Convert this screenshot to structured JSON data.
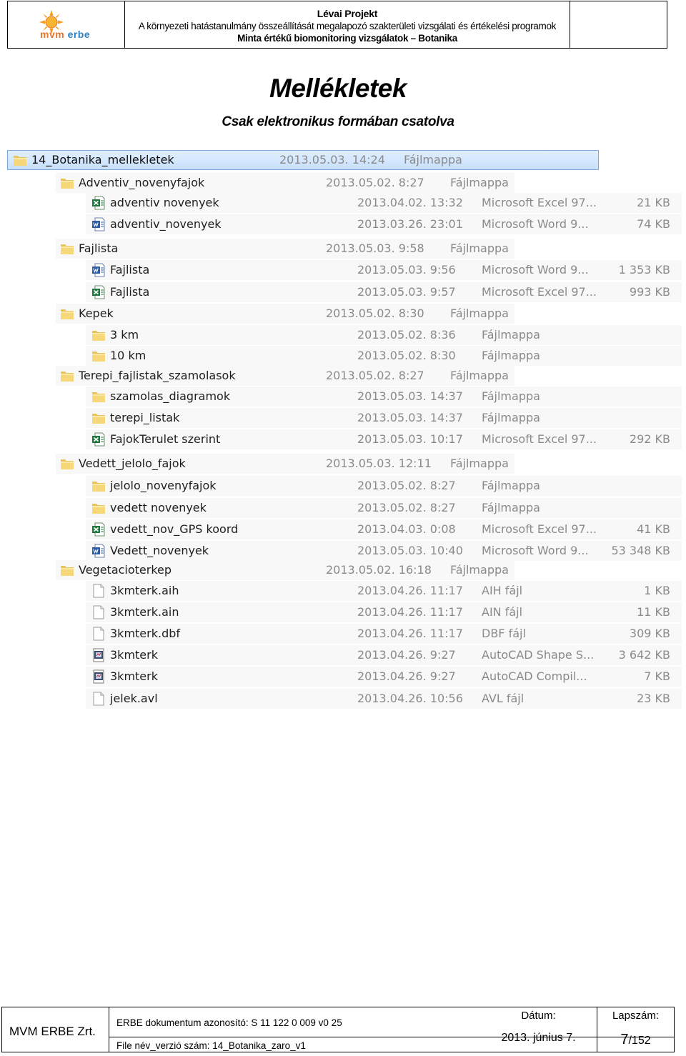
{
  "header": {
    "project": "Lévai Projekt",
    "line2": "A környezeti hatástanulmány összeállítását megalapozó szakterületi vizsgálati és értékelési programok",
    "line3": "Minta értékű biomonitoring vizsgálatok – Botanika",
    "logo_text_a": "mvm",
    "logo_text_b": " erbe"
  },
  "title": "Mellékletek",
  "subtitle": "Csak elektronikus formában csatolva",
  "listing": [
    {
      "name": "14_Botanika_mellekletek",
      "date": "2013.05.03. 14:24",
      "type": "Fájlmappa",
      "size": "",
      "icon": "folder-icon"
    },
    {
      "name": "Adventiv_novenyfajok",
      "date": "2013.05.02. 8:27",
      "type": "Fájlmappa",
      "size": "",
      "icon": "folder-icon"
    },
    {
      "name": "adventiv novenyek",
      "date": "2013.04.02. 13:32",
      "type": "Microsoft Excel 97...",
      "size": "21 KB",
      "icon": "excel-file-icon"
    },
    {
      "name": "adventiv_novenyek",
      "date": "2013.03.26. 23:01",
      "type": "Microsoft Word 9...",
      "size": "74 KB",
      "icon": "word-file-icon"
    },
    {
      "name": "Fajlista",
      "date": "2013.05.03. 9:58",
      "type": "Fájlmappa",
      "size": "",
      "icon": "folder-icon"
    },
    {
      "name": "Fajlista",
      "date": "2013.05.03. 9:56",
      "type": "Microsoft Word 9...",
      "size": "1 353 KB",
      "icon": "word-file-icon"
    },
    {
      "name": "Fajlista",
      "date": "2013.05.03. 9:57",
      "type": "Microsoft Excel 97...",
      "size": "993 KB",
      "icon": "excel-file-icon"
    },
    {
      "name": "Kepek",
      "date": "2013.05.02. 8:30",
      "type": "Fájlmappa",
      "size": "",
      "icon": "folder-icon"
    },
    {
      "name": "3 km",
      "date": "2013.05.02. 8:36",
      "type": "Fájlmappa",
      "size": "",
      "icon": "folder-icon"
    },
    {
      "name": "10 km",
      "date": "2013.05.02. 8:30",
      "type": "Fájlmappa",
      "size": "",
      "icon": "folder-icon"
    },
    {
      "name": "Terepi_fajlistak_szamolasok",
      "date": "2013.05.02. 8:27",
      "type": "Fájlmappa",
      "size": "",
      "icon": "folder-icon"
    },
    {
      "name": "szamolas_diagramok",
      "date": "2013.05.03. 14:37",
      "type": "Fájlmappa",
      "size": "",
      "icon": "folder-icon"
    },
    {
      "name": "terepi_listak",
      "date": "2013.05.03. 14:37",
      "type": "Fájlmappa",
      "size": "",
      "icon": "folder-icon"
    },
    {
      "name": "FajokTerulet szerint",
      "date": "2013.05.03. 10:17",
      "type": "Microsoft Excel 97...",
      "size": "292 KB",
      "icon": "excel-file-icon"
    },
    {
      "name": "Vedett_jelolo_fajok",
      "date": "2013.05.03. 12:11",
      "type": "Fájlmappa",
      "size": "",
      "icon": "folder-icon"
    },
    {
      "name": "jelolo_novenyfajok",
      "date": "2013.05.02. 8:27",
      "type": "Fájlmappa",
      "size": "",
      "icon": "folder-icon"
    },
    {
      "name": "vedett novenyek",
      "date": "2013.05.02. 8:27",
      "type": "Fájlmappa",
      "size": "",
      "icon": "folder-icon"
    },
    {
      "name": "vedett_nov_GPS koord",
      "date": "2013.04.03. 0:08",
      "type": "Microsoft Excel 97...",
      "size": "41 KB",
      "icon": "excel-file-icon"
    },
    {
      "name": "Vedett_novenyek",
      "date": "2013.05.03. 10:40",
      "type": "Microsoft Word 9...",
      "size": "53 348 KB",
      "icon": "word-file-icon"
    },
    {
      "name": "Vegetacioterkep",
      "date": "2013.05.02. 16:18",
      "type": "Fájlmappa",
      "size": "",
      "icon": "folder-icon"
    },
    {
      "name": "3kmterk.aih",
      "date": "2013.04.26. 11:17",
      "type": "AIH fájl",
      "size": "1 KB",
      "icon": "blank-file-icon"
    },
    {
      "name": "3kmterk.ain",
      "date": "2013.04.26. 11:17",
      "type": "AIN fájl",
      "size": "11 KB",
      "icon": "blank-file-icon"
    },
    {
      "name": "3kmterk.dbf",
      "date": "2013.04.26. 11:17",
      "type": "DBF fájl",
      "size": "309 KB",
      "icon": "blank-file-icon"
    },
    {
      "name": "3kmterk",
      "date": "2013.04.26. 9:27",
      "type": "AutoCAD Shape S...",
      "size": "3 642 KB",
      "icon": "autocad-file-icon"
    },
    {
      "name": "3kmterk",
      "date": "2013.04.26. 9:27",
      "type": "AutoCAD Compil...",
      "size": "7 KB",
      "icon": "autocad-file-icon"
    },
    {
      "name": "jelek.avl",
      "date": "2013.04.26. 10:56",
      "type": "AVL fájl",
      "size": "23 KB",
      "icon": "blank-file-icon"
    }
  ],
  "footer": {
    "company": "MVM ERBE Zrt.",
    "doc_id": "ERBE dokumentum azonosító: S 11 122 0 009 v0 25",
    "file_name": "File név_verzió szám: 14_Botanika_zaro_v1",
    "date_label": "Dátum:",
    "date_value": "2013. június 7.",
    "page_label": "Lapszám:",
    "page_current": "7",
    "page_total": "/152"
  }
}
